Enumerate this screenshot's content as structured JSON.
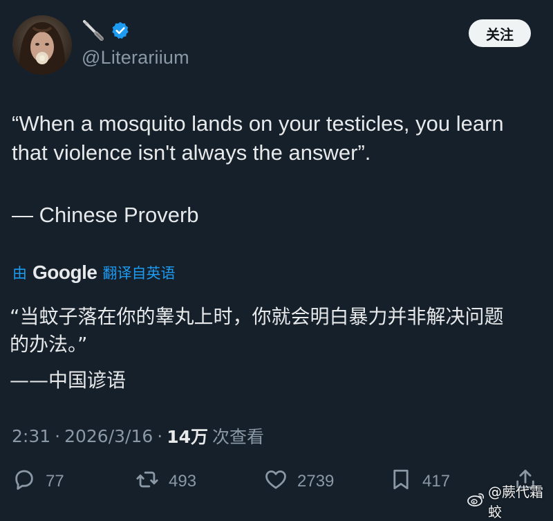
{
  "account": {
    "display_name_icon": "quill-pen-icon",
    "verified_icon": "verified-badge-icon",
    "handle": "@Literariium",
    "follow_label": "关注"
  },
  "tweet": {
    "text": "“When a mosquito lands on your testicles, you learn\nthat violence isn't always the answer”.",
    "attribution": "— Chinese Proverb"
  },
  "translation": {
    "prefix": "由",
    "provider": "Google",
    "suffix": "翻译自英语",
    "text": "“当蚊子落在你的睾丸上时，你就会明白暴力并非解决问题\n的办法。”",
    "attribution": "——中国谚语"
  },
  "meta": {
    "time": "2:31",
    "date": "2026/3/16",
    "views_count": "14万",
    "views_label": "次查看"
  },
  "actions": {
    "replies": "77",
    "reposts": "493",
    "likes": "2739",
    "bookmarks": "417"
  },
  "watermark": {
    "text": "@蕨代霜蛟"
  },
  "colors": {
    "background": "#15202b",
    "primary_text": "#e7e9ea",
    "secondary_text": "#8b98a5",
    "accent": "#1d9bf0",
    "follow_button_bg": "#eff3f4"
  }
}
